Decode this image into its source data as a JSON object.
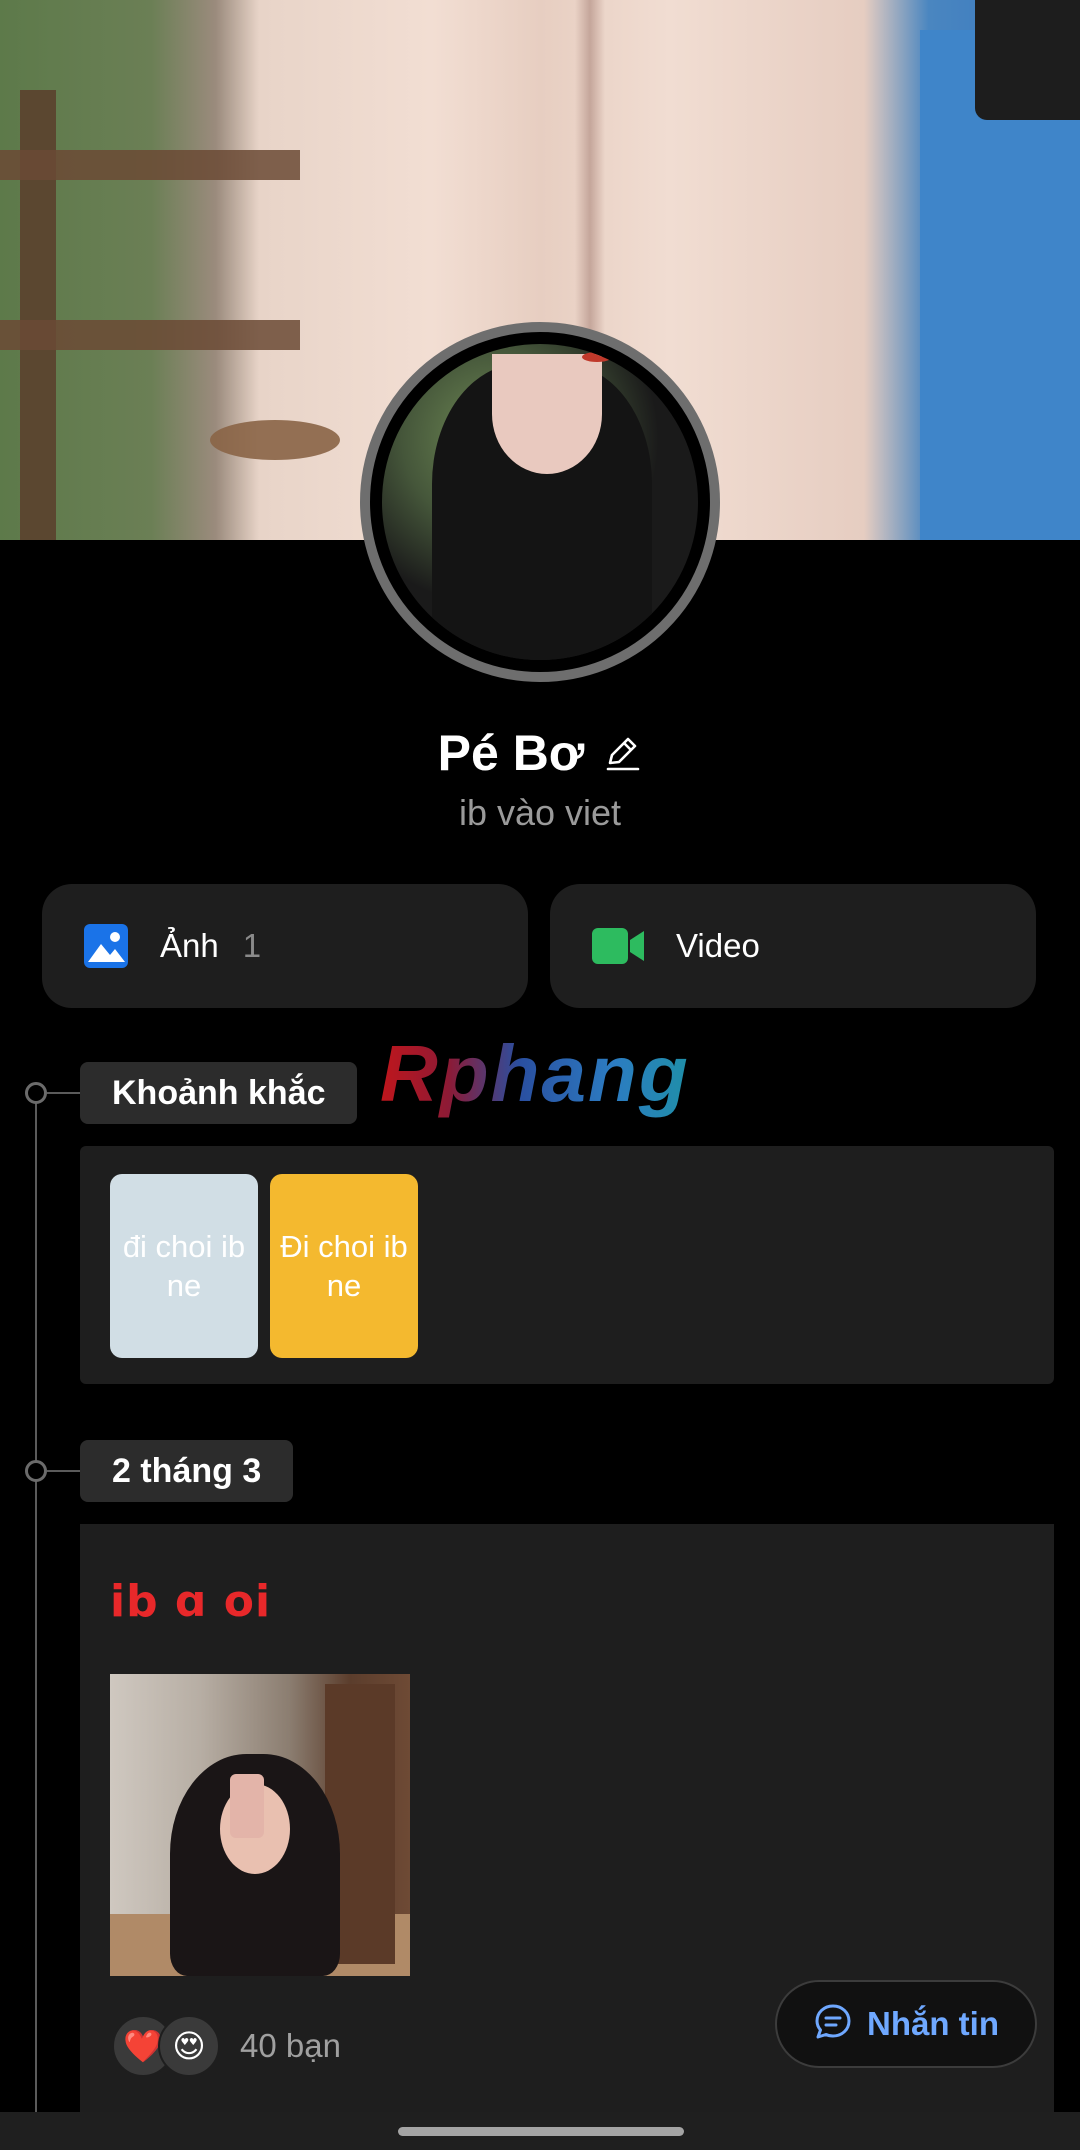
{
  "profile": {
    "name": "Pé Bơ",
    "bio": "ib vào viet"
  },
  "media": {
    "photo_label": "Ảnh",
    "photo_count": "1",
    "video_label": "Video"
  },
  "watermark": "Rphang",
  "timeline": {
    "moments_label": "Khoảnh khắc",
    "moments": [
      {
        "text": "đi choi ib ne",
        "color": "#d1dee5"
      },
      {
        "text": "Đi choi ib ne",
        "color": "#f4b92f"
      }
    ],
    "date_label": "2 tháng 3",
    "post": {
      "title": "ib ɑ oi",
      "reaction_1": "❤️",
      "reaction_2": "😍",
      "friends": "40 bạn"
    }
  },
  "actions": {
    "message_label": "Nhắn tin"
  },
  "colors": {
    "accent_blue": "#6fa8ff",
    "post_title_red": "#e8282a",
    "photo_icon_blue": "#1a73e8",
    "video_icon_green": "#2dbb5f"
  },
  "icons": [
    "edit-icon",
    "image-icon",
    "video-camera-icon",
    "chat-bubble-icon"
  ]
}
